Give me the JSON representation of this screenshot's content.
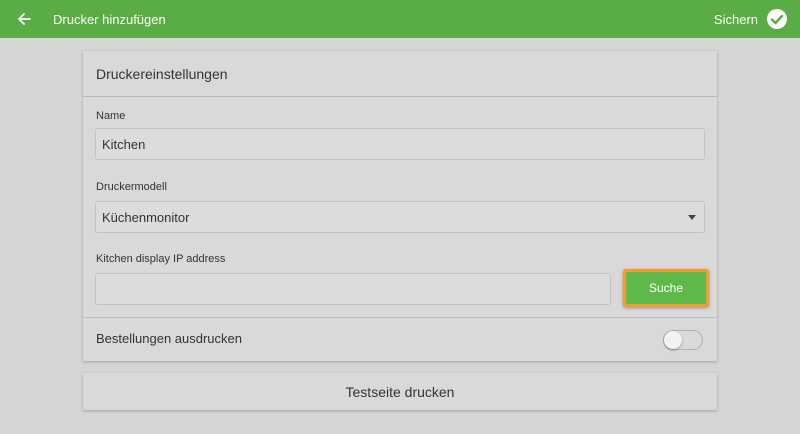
{
  "header": {
    "title": "Drucker hinzufügen",
    "save_label": "Sichern",
    "back_icon": "arrow-left-icon",
    "save_icon": "check-circle-icon",
    "bar_color": "#5aac44"
  },
  "settings": {
    "heading": "Druckereinstellungen",
    "name_label": "Name",
    "name_value": "Kitchen",
    "model_label": "Druckermodell",
    "model_value": "Küchenmonitor",
    "ip_label": "Kitchen display IP address",
    "ip_value": "",
    "search_label": "Suche",
    "print_orders_label": "Bestellungen ausdrucken",
    "print_orders_enabled": false
  },
  "test_print": {
    "label": "Testseite drucken"
  },
  "colors": {
    "accent": "#5fb94a",
    "highlight": "#f39c2a",
    "background": "#d6d6d6"
  }
}
